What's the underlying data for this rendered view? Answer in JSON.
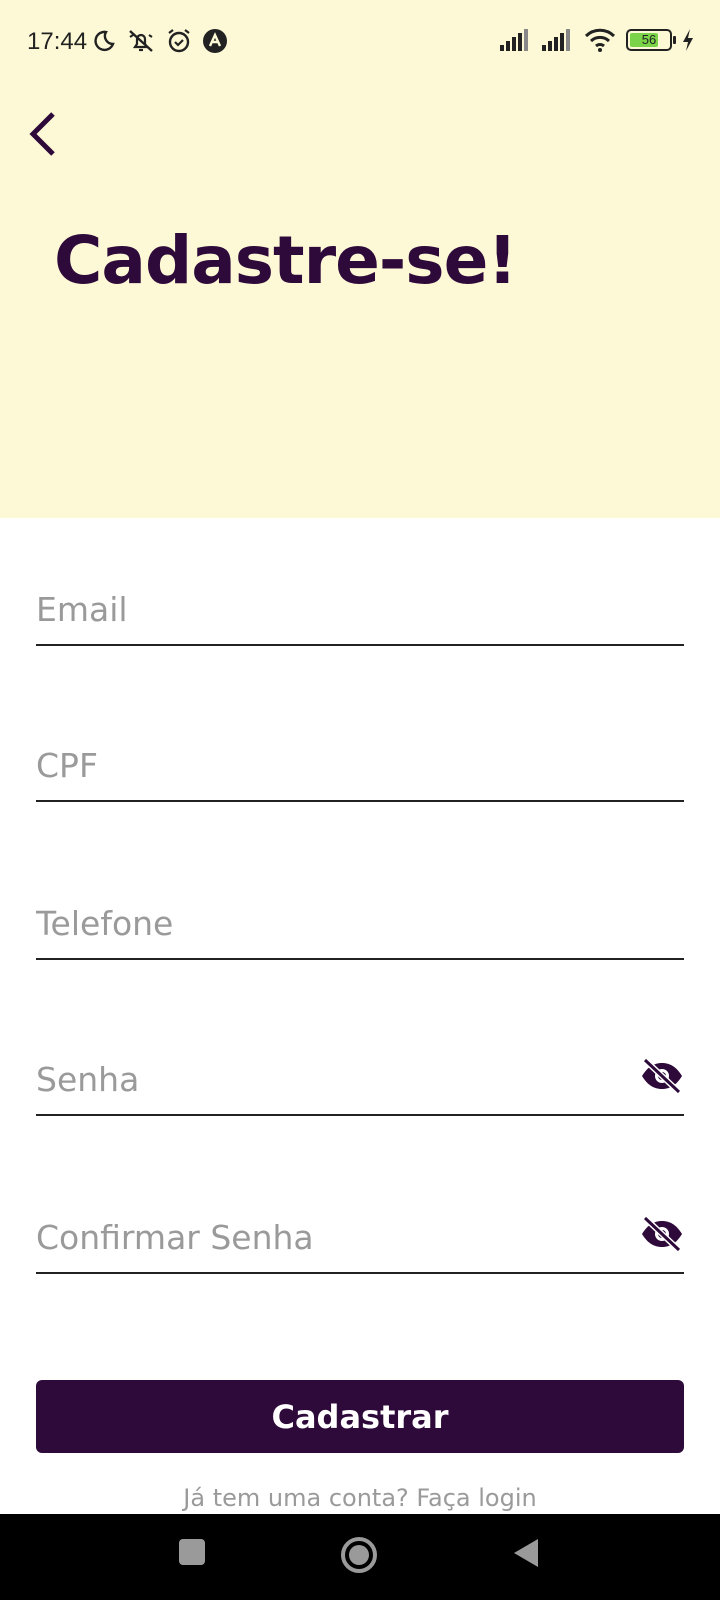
{
  "status_bar": {
    "time": "17:44",
    "battery": "56",
    "icons": [
      "moon-icon",
      "bell-off-icon",
      "alarm-icon",
      "app-notification-icon",
      "signal-icon",
      "signal-icon",
      "wifi-icon",
      "battery-icon",
      "charging-icon"
    ]
  },
  "header": {
    "title": "Cadastre-se!",
    "back_icon": "chevron-left-icon"
  },
  "form": {
    "fields": [
      {
        "placeholder": "Email",
        "value": ""
      },
      {
        "placeholder": "CPF",
        "value": ""
      },
      {
        "placeholder": "Telefone",
        "value": ""
      },
      {
        "placeholder": "Senha",
        "value": "",
        "visibility_icon": "eye-off-icon"
      },
      {
        "placeholder": "Confirmar Senha",
        "value": "",
        "visibility_icon": "eye-off-icon"
      }
    ],
    "submit_label": "Cadastrar",
    "login_prompt": "Já tem uma conta? Faça login"
  },
  "navigation": {
    "buttons": [
      "recent-apps-icon",
      "home-icon",
      "back-icon"
    ]
  },
  "colors": {
    "header_bg": "#fdf9d6",
    "primary": "#2e0a3a",
    "placeholder": "#9a9a9a",
    "battery_fill": "#7bd34a"
  }
}
